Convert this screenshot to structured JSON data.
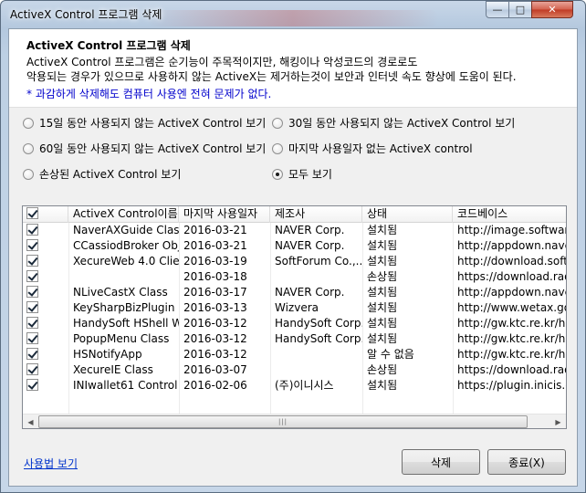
{
  "window": {
    "title": "ActiveX Control 프로그램 삭제",
    "min": "—",
    "max": "□",
    "close": "✕"
  },
  "header": {
    "title": "ActiveX Control 프로그램 삭제",
    "desc1": "ActiveX Control 프로그램은 순기능이 주목적이지만, 해킹이나 악성코드의 경로로도",
    "desc2": "악용되는 경우가 있으므로 사용하지 않는 ActiveX는 제거하는것이 보안과 인터넷 속도 향상에 도움이 된다.",
    "note": "* 과감하게 삭제해도 컴퓨터 사용엔 전혀 문제가 없다."
  },
  "filters": [
    {
      "label": "15일 동안 사용되지 않는 ActiveX Control 보기",
      "selected": false
    },
    {
      "label": "30일 동안 사용되지 않는 ActiveX Control 보기",
      "selected": false
    },
    {
      "label": "60일 동안 사용되지 않는 ActiveX Control 보기",
      "selected": false
    },
    {
      "label": "마지막 사용일자 없는 ActiveX control",
      "selected": false
    },
    {
      "label": "손상된 ActiveX Control 보기",
      "selected": false
    },
    {
      "label": "모두 보기",
      "selected": true
    }
  ],
  "table": {
    "headers": [
      "ActiveX Control이름",
      "마지막 사용일자",
      "제조사",
      "상태",
      "코드베이스"
    ],
    "rows": [
      {
        "name": "NaverAXGuide Class",
        "date": "2016-03-21",
        "vendor": "NAVER Corp.",
        "status": "설치됨",
        "codebase": "http://image.software.n"
      },
      {
        "name": "CCassiodBroker Obj...",
        "date": "2016-03-21",
        "vendor": "NAVER Corp.",
        "status": "설치됨",
        "codebase": "http://appdown.naver.c"
      },
      {
        "name": "XecureWeb 4.0 Clie...",
        "date": "2016-03-19",
        "vendor": "SoftForum Co.,...",
        "status": "설치됨",
        "codebase": "http://download.softfor"
      },
      {
        "name": "",
        "date": "2016-03-18",
        "vendor": "",
        "status": "손상됨",
        "codebase": "https://download.raonse"
      },
      {
        "name": "NLiveCastX Class",
        "date": "2016-03-17",
        "vendor": "NAVER Corp.",
        "status": "설치됨",
        "codebase": "http://appdown.naver.c"
      },
      {
        "name": "KeySharpBizPlugin ...",
        "date": "2016-03-13",
        "vendor": "Wizvera",
        "status": "설치됨",
        "codebase": "http://www.wetax.go.kr"
      },
      {
        "name": "HandySoft HShell W...",
        "date": "2016-03-12",
        "vendor": "HandySoft Corp.",
        "status": "설치됨",
        "codebase": "http://gw.ktc.re.kr/hshe"
      },
      {
        "name": "PopupMenu Class",
        "date": "2016-03-12",
        "vendor": "HandySoft Corp.",
        "status": "설치됨",
        "codebase": "http://gw.ktc.re.kr/hwel"
      },
      {
        "name": "HSNotifyApp",
        "date": "2016-03-12",
        "vendor": "",
        "status": "알 수 없음",
        "codebase": "http://gw.ktc.re.kr/hsno"
      },
      {
        "name": "XecureIE Class",
        "date": "2016-03-07",
        "vendor": "",
        "status": "손상됨",
        "codebase": "https://download.raonse"
      },
      {
        "name": "INIwallet61 Control",
        "date": "2016-02-06",
        "vendor": "(주)이니시스",
        "status": "설치됨",
        "codebase": "https://plugin.inicis.com/"
      }
    ]
  },
  "footer": {
    "usage_link": "사용법 보기",
    "delete_label": "삭제",
    "exit_label": "종료(X)"
  }
}
